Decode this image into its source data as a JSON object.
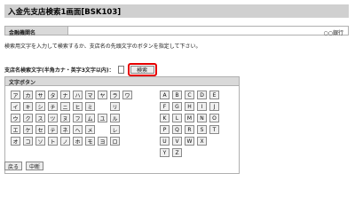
{
  "page": {
    "title": "入金先支店検索1画面[BSK103]"
  },
  "bank": {
    "label": "金融機関名",
    "value": "○○銀行"
  },
  "instruction": "検索用文字を入力して検索するか、支店名の先頭文字のボタンを指定して下さい。",
  "search": {
    "label": "支店名検索文字(半角カナ・英字3文字以内)：",
    "input_value": "",
    "button_label": "検索"
  },
  "keys": {
    "header": "文字ボタン",
    "kana_rows": [
      [
        "ア",
        "カ",
        "サ",
        "タ",
        "ナ",
        "ハ",
        "マ",
        "ヤ",
        "ラ",
        "ワ"
      ],
      [
        "イ",
        "キ",
        "シ",
        "チ",
        "ニ",
        "ヒ",
        "ミ",
        "",
        "リ",
        ""
      ],
      [
        "ウ",
        "ク",
        "ス",
        "ツ",
        "ヌ",
        "フ",
        "ム",
        "ユ",
        "ル",
        ""
      ],
      [
        "エ",
        "ケ",
        "セ",
        "テ",
        "ネ",
        "ヘ",
        "メ",
        "",
        "レ",
        ""
      ],
      [
        "オ",
        "コ",
        "ソ",
        "ト",
        "ノ",
        "ホ",
        "モ",
        "ヨ",
        "ロ",
        ""
      ]
    ],
    "alpha_rows": [
      [
        "A",
        "B",
        "C",
        "D",
        "E"
      ],
      [
        "F",
        "G",
        "H",
        "I",
        "J"
      ],
      [
        "K",
        "L",
        "M",
        "N",
        "O"
      ],
      [
        "P",
        "Q",
        "R",
        "S",
        "T"
      ],
      [
        "U",
        "V",
        "W",
        "X",
        ""
      ],
      [
        "Y",
        "Z",
        "",
        "",
        ""
      ]
    ]
  },
  "footer": {
    "back_label": "戻る",
    "cancel_label": "中断"
  }
}
